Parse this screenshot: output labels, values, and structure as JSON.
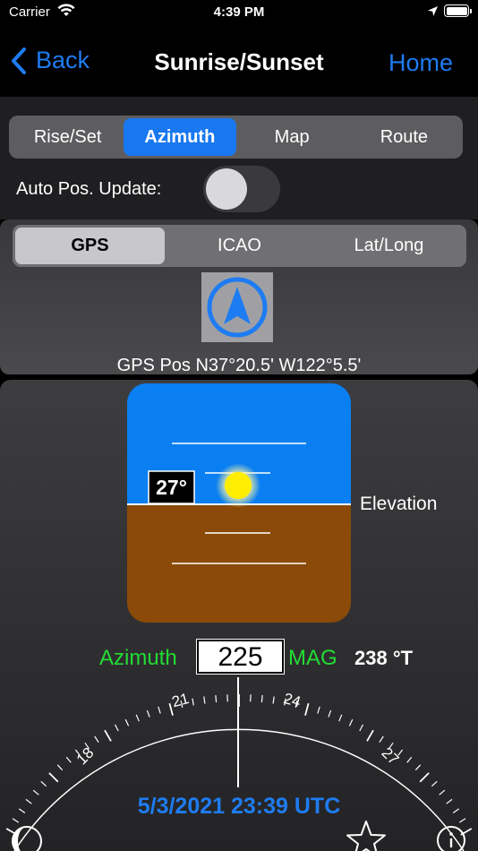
{
  "status_bar": {
    "carrier": "Carrier",
    "time": "4:39 PM"
  },
  "nav": {
    "back_label": "Back",
    "title": "Sunrise/Sunset",
    "home_label": "Home"
  },
  "mode_tabs": [
    {
      "label": "Rise/Set",
      "active": false
    },
    {
      "label": "Azimuth",
      "active": true
    },
    {
      "label": "Map",
      "active": false
    },
    {
      "label": "Route",
      "active": false
    }
  ],
  "auto_update": {
    "label": "Auto Pos. Update:",
    "on": false
  },
  "source_tabs": [
    {
      "label": "GPS",
      "active": true
    },
    {
      "label": "ICAO",
      "active": false
    },
    {
      "label": "Lat/Long",
      "active": false
    }
  ],
  "gps_position": "GPS Pos N37°20.5' W122°5.5'",
  "elevation": {
    "label": "Elevation",
    "value": "27°"
  },
  "azimuth": {
    "label": "Azimuth",
    "value": "225",
    "mag_label": "MAG",
    "true_value": "238 °T"
  },
  "compass_ticks": [
    "18",
    "21",
    "24",
    "27"
  ],
  "datetime": "5/3/2021 23:39 UTC",
  "icons": [
    "wifi-icon",
    "location-arrow-icon",
    "battery-icon",
    "chevron-left-icon",
    "gps-navigation-icon",
    "sun-icon",
    "moon-phase-icon",
    "star-icon",
    "info-icon"
  ],
  "colors": {
    "accent": "#1e7cf2",
    "sky": "#0a7ff2",
    "ground": "#8b4a07",
    "sun": "#ffee00",
    "azimuth_label": "#22dd33"
  }
}
